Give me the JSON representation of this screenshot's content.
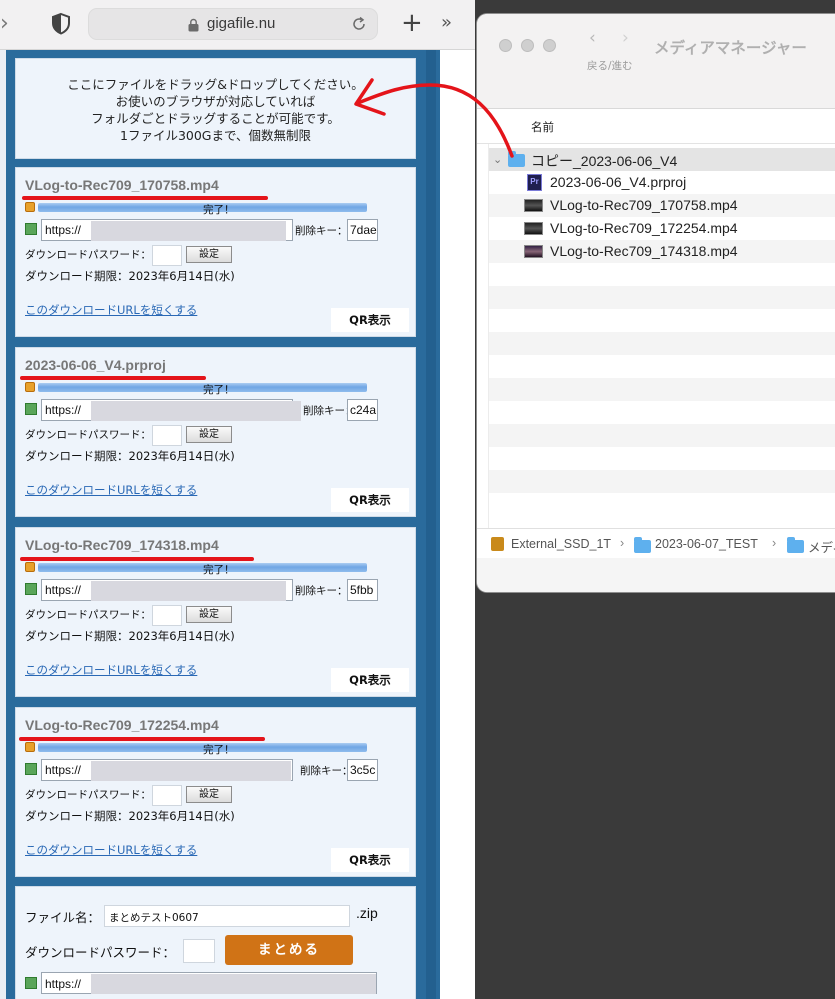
{
  "browser": {
    "url": "gigafile.nu",
    "drop_zone": {
      "lines": [
        "ここにファイルをドラッグ&ドロップしてください。",
        "お使いのブラウザが対応していれば",
        "フォルダごとドラッグすることが可能です。",
        "1ファイル300Gまで、個数無制限"
      ]
    },
    "files": [
      {
        "name": "VLog-to-Rec709_170758.mp4",
        "status": "完了！",
        "url": "https://",
        "delete_label": "削除キー：",
        "delete_key": "7dae",
        "password_label": "ダウンロードパスワード：",
        "set_label": "設定",
        "expiry": "ダウンロード期限：2023年6月14日(水)",
        "shorten_link": "このダウンロードURLを短くする",
        "qr_label": "QR表示"
      },
      {
        "name": "2023-06-06_V4.prproj",
        "status": "完了！",
        "url": "https://",
        "delete_label": "削除キー：",
        "delete_key": "c24a",
        "password_label": "ダウンロードパスワード：",
        "set_label": "設定",
        "expiry": "ダウンロード期限：2023年6月14日(水)",
        "shorten_link": "このダウンロードURLを短くする",
        "qr_label": "QR表示"
      },
      {
        "name": "VLog-to-Rec709_174318.mp4",
        "status": "完了！",
        "url": "https://",
        "delete_label": "削除キー：",
        "delete_key": "5fbb",
        "password_label": "ダウンロードパスワード：",
        "set_label": "設定",
        "expiry": "ダウンロード期限：2023年6月14日(水)",
        "shorten_link": "このダウンロードURLを短くする",
        "qr_label": "QR表示"
      },
      {
        "name": "VLog-to-Rec709_172254.mp4",
        "status": "完了！",
        "url": "https://",
        "delete_label": "削除キー：",
        "delete_key": "3c5c",
        "password_label": "ダウンロードパスワード：",
        "set_label": "設定",
        "expiry": "ダウンロード期限：2023年6月14日(水)",
        "shorten_link": "このダウンロードURLを短くする",
        "qr_label": "QR表示"
      }
    ],
    "bundle": {
      "filename_label": "ファイル名：",
      "filename_value": "まとめテスト0607",
      "extension": ".zip",
      "password_label": "ダウンロードパスワード：",
      "button_label": "まとめる",
      "url": "https://"
    }
  },
  "finder": {
    "title": "メディアマネージャー",
    "nav_label": "戻る/進む",
    "column_name": "名前",
    "folder": "コピー_2023-06-06_V4",
    "items": [
      {
        "name": "2023-06-06_V4.prproj",
        "icon": "premiere-project-icon"
      },
      {
        "name": "VLog-to-Rec709_170758.mp4",
        "icon": "video-file-icon"
      },
      {
        "name": "VLog-to-Rec709_172254.mp4",
        "icon": "video-file-icon"
      },
      {
        "name": "VLog-to-Rec709_174318.mp4",
        "icon": "video-file-icon"
      }
    ],
    "path": [
      "External_SSD_1T",
      "2023-06-07_TEST",
      "メディ"
    ]
  },
  "colors": {
    "page_blue": "#2a6b9c",
    "panel_bg": "#eef4fb",
    "link": "#2968b5",
    "bundle_button": "#d07316",
    "annotation_red": "#e4141a",
    "folder_blue": "#5eb0ee"
  }
}
